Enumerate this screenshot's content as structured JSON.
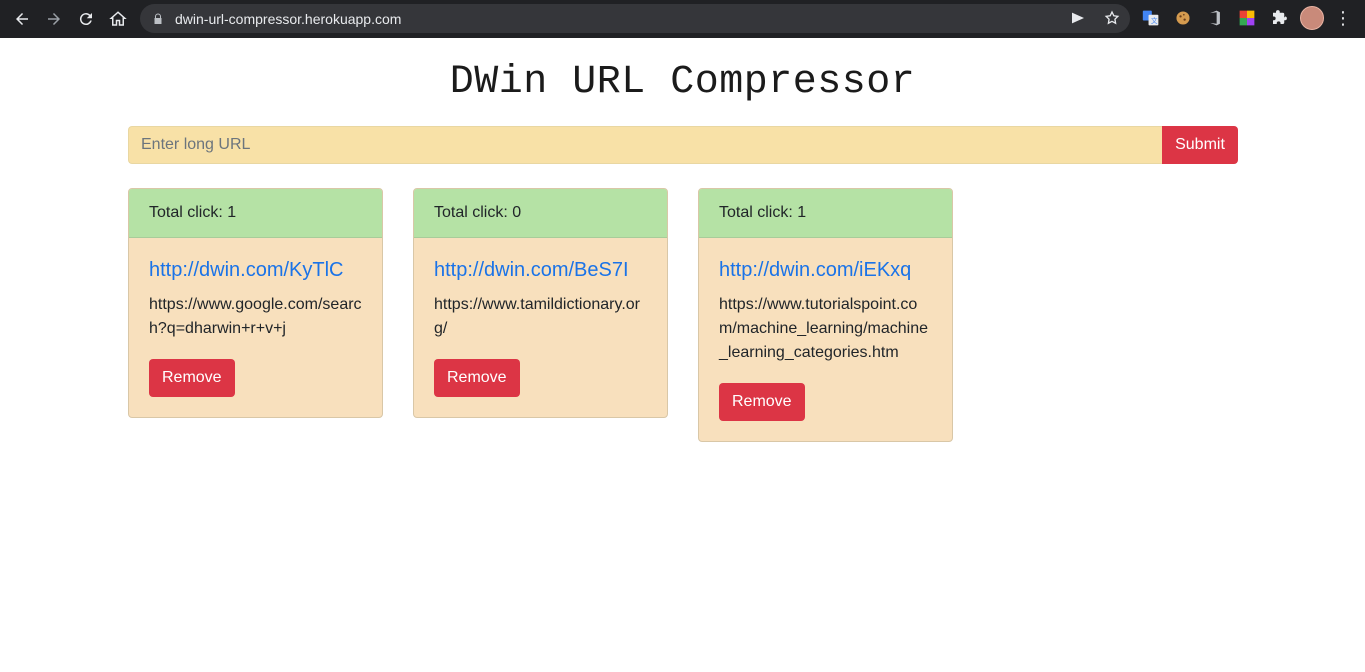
{
  "browser": {
    "url": "dwin-url-compressor.herokuapp.com",
    "back_icon": "arrow-left-icon",
    "forward_icon": "arrow-right-icon",
    "reload_icon": "reload-icon",
    "home_icon": "home-icon"
  },
  "page": {
    "title": "DWin URL Compressor"
  },
  "form": {
    "placeholder": "Enter long URL",
    "value": "",
    "submit_label": "Submit"
  },
  "cards": [
    {
      "clicks_text": "Total click: 1",
      "short_url": "http://dwin.com/KyTlC",
      "long_url": "https://www.google.com/search?q=dharwin+r+v+j",
      "remove_label": "Remove"
    },
    {
      "clicks_text": "Total click: 0",
      "short_url": "http://dwin.com/BeS7I",
      "long_url": "https://www.tamildictionary.org/",
      "remove_label": "Remove"
    },
    {
      "clicks_text": "Total click: 1",
      "short_url": "http://dwin.com/iEKxq",
      "long_url": "https://www.tutorialspoint.com/machine_learning/machine_learning_categories.htm",
      "remove_label": "Remove"
    }
  ],
  "colors": {
    "accent_red": "#dc3545",
    "card_header_green": "#b5e2a5",
    "card_body_peach": "#f8e0bd",
    "input_yellow": "#f8e1a7",
    "link_blue": "#1a73e8"
  }
}
